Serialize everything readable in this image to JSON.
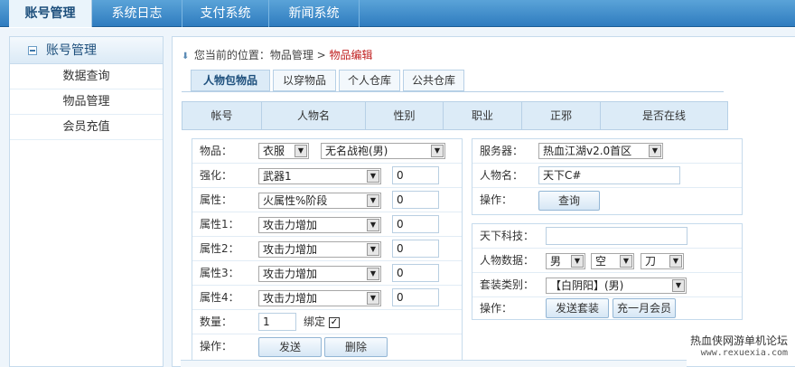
{
  "topnav": {
    "tabs": [
      {
        "label": "账号管理"
      },
      {
        "label": "系统日志"
      },
      {
        "label": "支付系统"
      },
      {
        "label": "新闻系统"
      }
    ]
  },
  "sidebar": {
    "title": "账号管理",
    "items": [
      {
        "label": "数据查询"
      },
      {
        "label": "物品管理"
      },
      {
        "label": "会员充值"
      }
    ]
  },
  "breadcrumb": {
    "prefix": "您当前的位置：物品管理 >",
    "current": "物品编辑"
  },
  "tabs": [
    {
      "label": "人物包物品"
    },
    {
      "label": "以穿物品"
    },
    {
      "label": "个人仓库"
    },
    {
      "label": "公共仓库"
    }
  ],
  "table_headers": [
    "帐号",
    "人物名",
    "性别",
    "职业",
    "正邪",
    "是否在线"
  ],
  "item_form": {
    "item_label": "物品：",
    "item_type": "衣服",
    "item_name": "无名战袍(男)",
    "enhance_label": "强化：",
    "enhance_select": "武器1",
    "enhance_value": "0",
    "attr_label": "属性：",
    "attr_select": "火属性%阶段",
    "attr_value": "0",
    "attr1_label": "属性1：",
    "attr1_select": "攻击力增加",
    "attr1_value": "0",
    "attr2_label": "属性2：",
    "attr2_select": "攻击力增加",
    "attr2_value": "0",
    "attr3_label": "属性3：",
    "attr3_select": "攻击力增加",
    "attr3_value": "0",
    "attr4_label": "属性4：",
    "attr4_select": "攻击力增加",
    "attr4_value": "0",
    "qty_label": "数量：",
    "qty_value": "1",
    "bind_label": "绑定",
    "bind_checked": true,
    "op_label": "操作：",
    "send_button": "发送",
    "delete_button": "删除"
  },
  "query_form": {
    "server_label": "服务器：",
    "server_value": "热血江湖v2.0首区",
    "char_label": "人物名：",
    "char_value": "天下C#",
    "op_label": "操作：",
    "query_button": "查询"
  },
  "set_form": {
    "tech_label": "天下科技：",
    "tech_value": "",
    "data_label": "人物数据：",
    "gender": "男",
    "element": "空",
    "weapon": "刀",
    "set_label": "套装类别：",
    "set_value": "【白阴阳】(男)",
    "op_label": "操作：",
    "send_set_button": "发送套装",
    "vip_button": "充一月会员"
  },
  "watermark": {
    "line1": "热血侠网游单机论坛",
    "line2": "www.rexuexia.com"
  },
  "colors": {
    "nav_blue": "#2f7cbf",
    "crumb_current": "#c02020",
    "panel_border": "#c6dbec"
  }
}
